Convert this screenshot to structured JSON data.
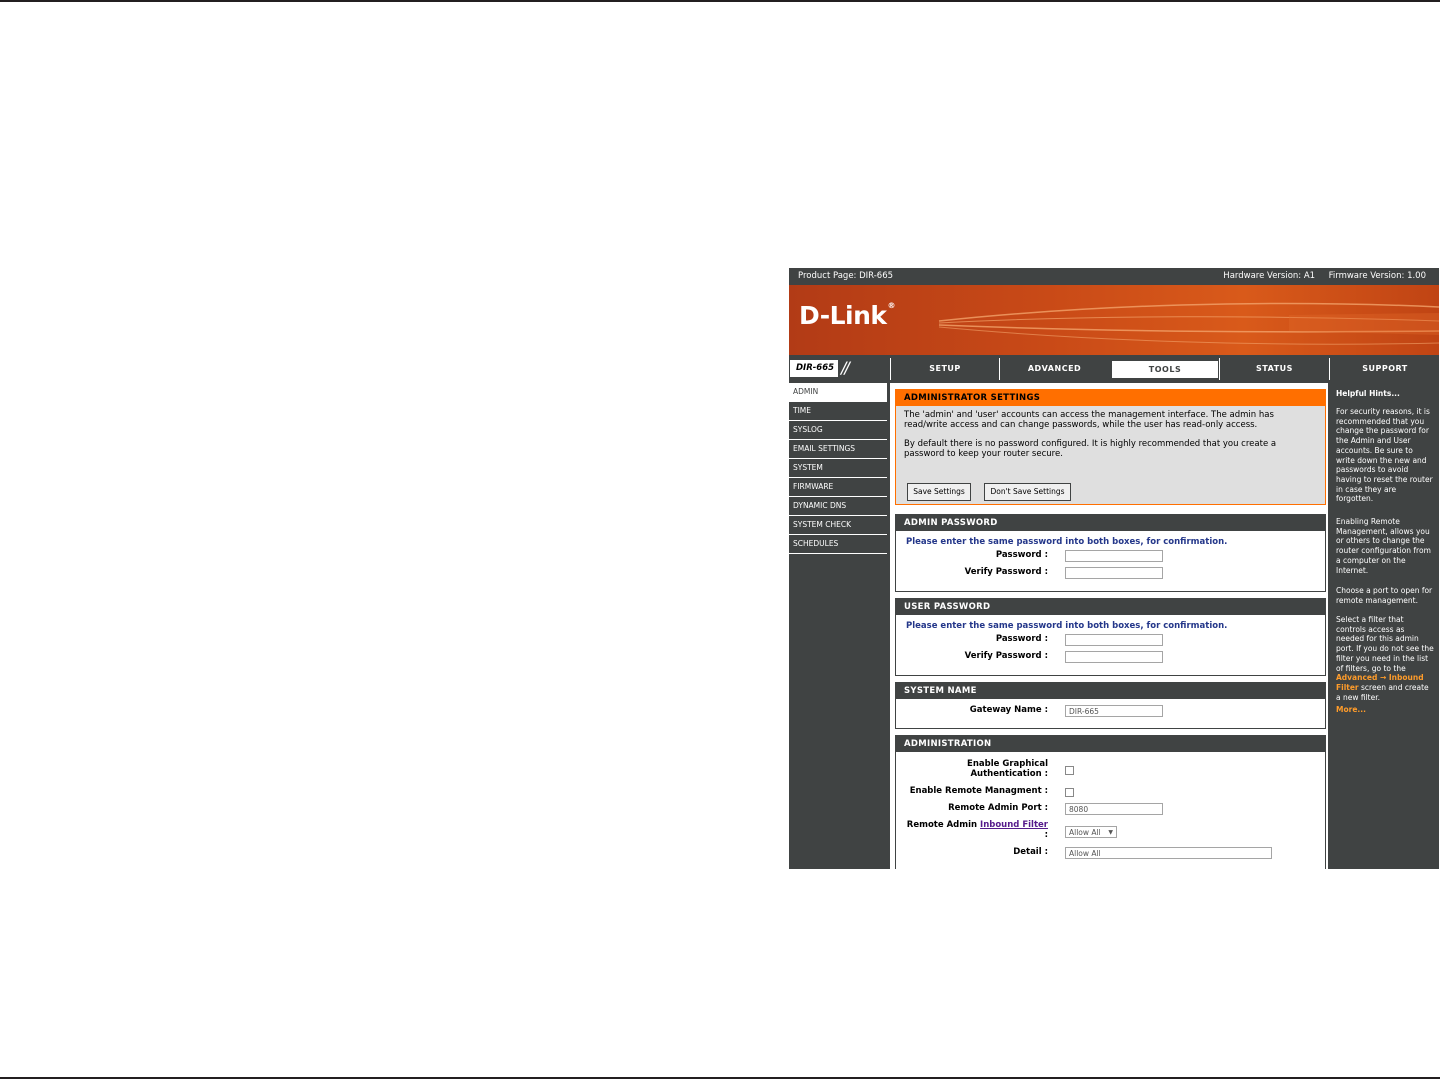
{
  "topbar": {
    "product_page": "Product Page: DIR-665",
    "versions": "Hardware Version: A1     Firmware Version: 1.00"
  },
  "brand": {
    "logo": "D-Link",
    "model": "DIR-665"
  },
  "tabs": [
    {
      "label": "SETUP"
    },
    {
      "label": "ADVANCED"
    },
    {
      "label": "TOOLS"
    },
    {
      "label": "STATUS"
    },
    {
      "label": "SUPPORT"
    }
  ],
  "sidebar": {
    "items": [
      {
        "label": "ADMIN"
      },
      {
        "label": "TIME"
      },
      {
        "label": "SYSLOG"
      },
      {
        "label": "EMAIL SETTINGS"
      },
      {
        "label": "SYSTEM"
      },
      {
        "label": "FIRMWARE"
      },
      {
        "label": "DYNAMIC DNS"
      },
      {
        "label": "SYSTEM CHECK"
      },
      {
        "label": "SCHEDULES"
      }
    ]
  },
  "admin_settings": {
    "title": "ADMINISTRATOR SETTINGS",
    "para1": "The 'admin' and 'user' accounts can access the management interface. The admin has read/write access and can change passwords, while the user has read-only access.",
    "para2": "By default there is no password configured. It is highly recommended that you create a password to keep your router secure.",
    "save_label": "Save Settings",
    "dont_save_label": "Don't Save Settings"
  },
  "admin_password": {
    "title": "ADMIN PASSWORD",
    "instruction": "Please enter the same password into both boxes, for confirmation.",
    "password_label": "Password :",
    "verify_label": "Verify Password :",
    "password_value": "",
    "verify_value": ""
  },
  "user_password": {
    "title": "USER PASSWORD",
    "instruction": "Please enter the same password into both boxes, for confirmation.",
    "password_label": "Password :",
    "verify_label": "Verify Password :",
    "password_value": "",
    "verify_value": ""
  },
  "system_name": {
    "title": "SYSTEM NAME",
    "gateway_label": "Gateway Name :",
    "gateway_value": "DIR-665"
  },
  "administration": {
    "title": "ADMINISTRATION",
    "graphical_auth_label_1": "Enable Graphical",
    "graphical_auth_label_2": "Authentication :",
    "remote_mgmt_label": "Enable Remote Managment :",
    "remote_port_label": "Remote Admin Port :",
    "remote_port_value": "8080",
    "inbound_prefix": "Remote Admin ",
    "inbound_link": "Inbound Filter",
    "inbound_suffix": ":",
    "inbound_value": "Allow All",
    "detail_label": "Detail :",
    "detail_value": "Allow All"
  },
  "hints": {
    "title": "Helpful Hints...",
    "h1": "For security reasons, it is recommended that you change the password for the Admin and User accounts. Be sure to write down the new and passwords to avoid having to reset the router in case they are forgotten.",
    "h2": "Enabling Remote Management, allows you or others to change the router configuration from a computer on the Internet.",
    "h3": "Choose a port to open for remote management.",
    "h4_pre": "Select a filter that controls access as needed for this admin port. If you do not see the filter you need in the list of filters, go to the ",
    "h4_link": "Advanced → Inbound Filter",
    "h4_post": " screen and create a new filter.",
    "more": "More..."
  },
  "colors": {
    "accent": "#ff6f00",
    "dark": "#404343",
    "instruction": "#24378a"
  }
}
